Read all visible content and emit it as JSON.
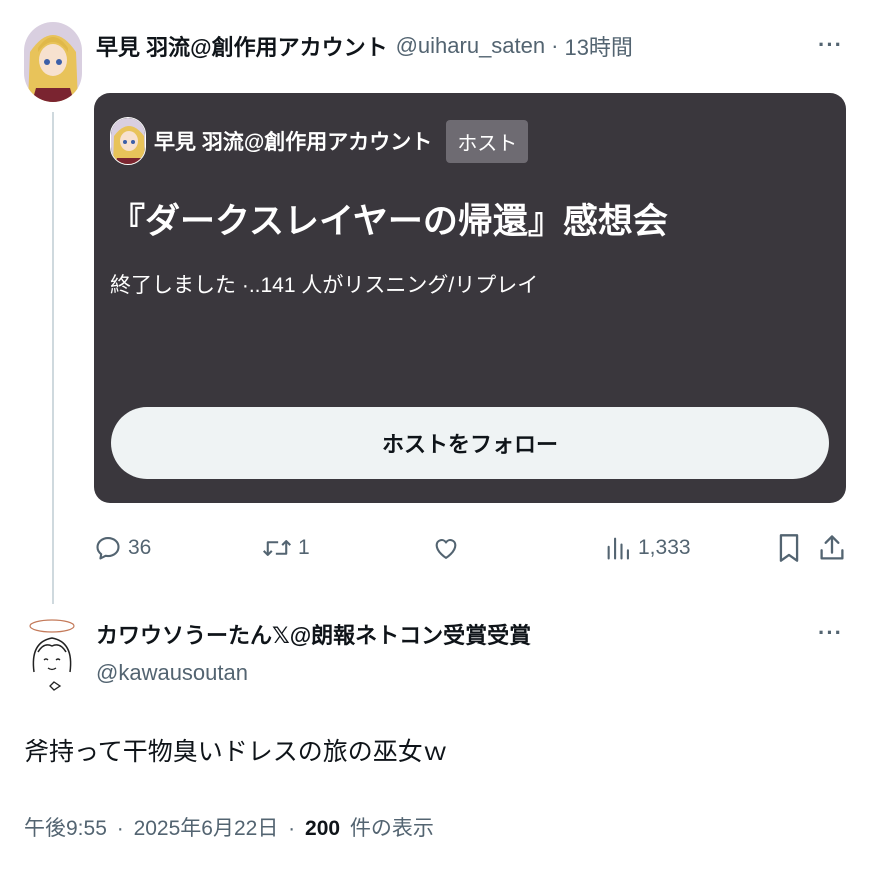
{
  "tweet1": {
    "display_name": "早見 羽流@創作用アカウント",
    "handle": "@uiharu_saten",
    "separator": "·",
    "time": "13時間",
    "more_icon": "···",
    "space_card": {
      "host_name": "早見 羽流@創作用アカウント",
      "host_badge": "ホスト",
      "title": "『ダークスレイヤーの帰還』感想会",
      "status": "終了しました ·..141 人がリスニング/リプレイ",
      "follow_button": "ホストをフォロー",
      "background_color": "#3a373d"
    },
    "actions": {
      "replies": "36",
      "reposts": "1",
      "likes": "",
      "views": "1,333"
    }
  },
  "tweet2": {
    "display_name": "カワウソうーたん𝕏@朗報ネトコン受賞受賞",
    "handle": "@kawausoutan",
    "more_icon": "···",
    "body": "斧持って干物臭いドレスの旅の巫女ｗ",
    "time": "午後9:55",
    "date": "2025年6月22日",
    "separator": "·",
    "views_count": "200",
    "views_label": "件の表示"
  },
  "colors": {
    "text_primary": "#0f1419",
    "text_secondary": "#536471",
    "thread_line": "#cfd9de",
    "follow_button_bg": "#eff3f4"
  },
  "icons": [
    "reply-icon",
    "repost-icon",
    "like-icon",
    "views-icon",
    "bookmark-icon",
    "share-icon",
    "more-icon"
  ]
}
